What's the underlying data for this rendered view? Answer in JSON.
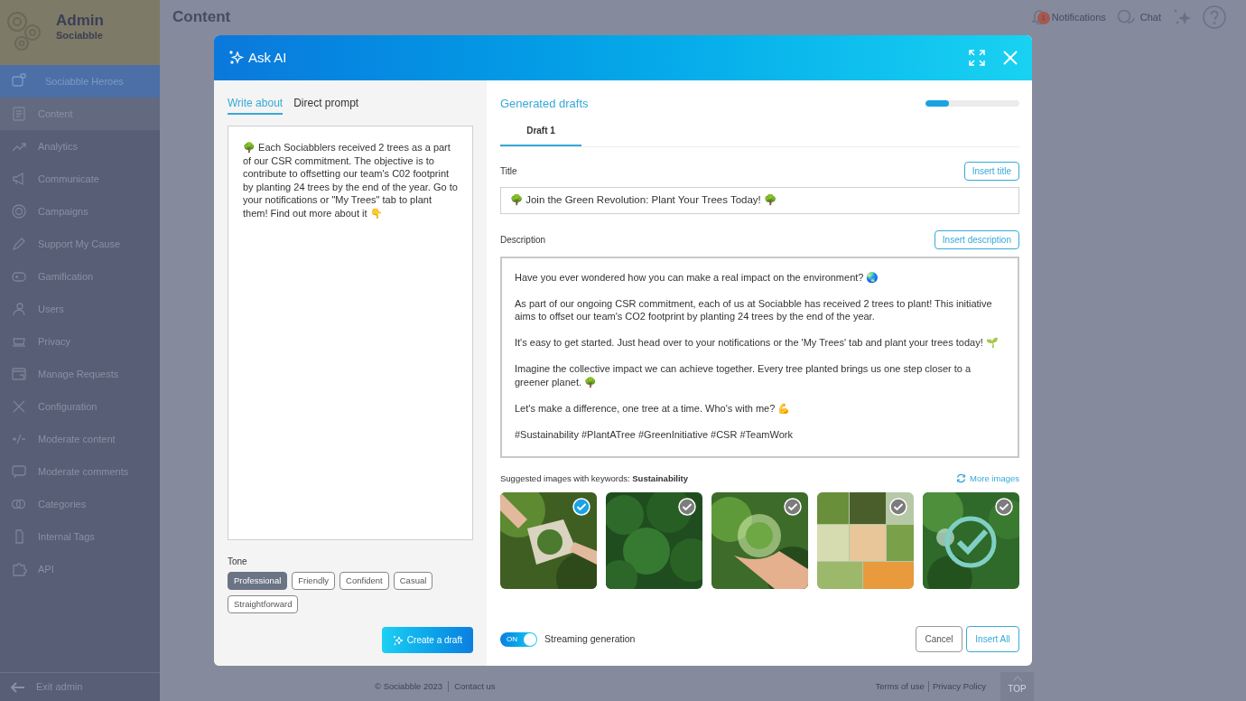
{
  "sidebar": {
    "title": "Admin",
    "subtitle": "Sociabble",
    "items": [
      {
        "label": "Sociabble Heroes",
        "selected": true,
        "kind": "heroes"
      },
      {
        "label": "Content",
        "selected": false,
        "kind": "content",
        "hover": true
      },
      {
        "label": "Analytics",
        "selected": false,
        "kind": "analytics"
      },
      {
        "label": "Communicate",
        "selected": false,
        "kind": "communicate"
      },
      {
        "label": "Campaigns",
        "selected": false,
        "kind": "campaigns"
      },
      {
        "label": "Support My Cause",
        "selected": false,
        "kind": "cause"
      },
      {
        "label": "Gamification",
        "selected": false,
        "kind": "gamification"
      },
      {
        "label": "Users",
        "selected": false,
        "kind": "users"
      },
      {
        "label": "Privacy",
        "selected": false,
        "kind": "privacy"
      },
      {
        "label": "Manage Requests",
        "selected": false,
        "kind": "requests"
      },
      {
        "label": "Configuration",
        "selected": false,
        "kind": "configuration"
      },
      {
        "label": "Moderate content",
        "selected": false,
        "kind": "moderate"
      },
      {
        "label": "Moderate comments",
        "selected": false,
        "kind": "comments"
      },
      {
        "label": "Categories",
        "selected": false,
        "kind": "categories"
      },
      {
        "label": "Internal Tags",
        "selected": false,
        "kind": "tags"
      },
      {
        "label": "API",
        "selected": false,
        "kind": "api"
      }
    ],
    "exit": "Exit admin"
  },
  "header": {
    "title": "Content",
    "notifications": {
      "label": "Notifications",
      "badge": "1"
    },
    "chat": "Chat"
  },
  "footer": {
    "copyright": "© Sociabble 2023",
    "contact": "Contact us",
    "terms": "Terms of use",
    "privacy": "Privacy Policy",
    "top": "TOP"
  },
  "dialog": {
    "title": "Ask AI",
    "left": {
      "tabs": [
        {
          "label": "Write about",
          "selected": true
        },
        {
          "label": "Direct prompt",
          "selected": false
        }
      ],
      "prompt": "🌳 Each Sociabblers received 2 trees as a part of our CSR commitment. The objective is to contribute to offsetting our team's C02 footprint by planting 24 trees by the end of the year. Go to your notifications or \"My Trees\" tab to plant them! Find out more about it 👇",
      "tone_label": "Tone",
      "tones": [
        {
          "label": "Professional",
          "selected": true
        },
        {
          "label": "Friendly",
          "selected": false
        },
        {
          "label": "Confident",
          "selected": false
        },
        {
          "label": "Casual",
          "selected": false
        },
        {
          "label": "Straightforward",
          "selected": false
        }
      ],
      "create_button": "Create a draft"
    },
    "right": {
      "heading": "Generated drafts",
      "progress": {
        "level": 0.25
      },
      "tabs": [
        {
          "label": "Draft 1",
          "selected": true
        }
      ],
      "title_label": "Title",
      "insert_title": "Insert title",
      "title_value": "🌳 Join the Green Revolution: Plant Your Trees Today! 🌳",
      "description_label": "Description",
      "insert_description": "Insert description",
      "description": [
        "Have you ever wondered how you can make a real impact on the environment? 🌏",
        "As part of our ongoing CSR commitment, each of us at Sociabble has received 2 trees to plant! This initiative aims to offset our team's CO2 footprint by planting 24 trees by the end of the year.",
        "It's easy to get started. Just head over to your notifications or the 'My Trees' tab and plant your trees today! 🌱",
        "Imagine the collective impact we can achieve together. Every tree planted brings us one step closer to a greener planet. 🌳",
        "Let's make a difference, one tree at a time. Who's with me? 💪",
        "#Sustainability #PlantATree #GreenInitiative #CSR #TeamWork"
      ],
      "images_label": "Suggested images with keywords: **Sustainability**",
      "more_images": "More images",
      "images": [
        {
          "kind": "picture",
          "selected": true
        },
        {
          "kind": "picture",
          "selected": false
        },
        {
          "kind": "picture",
          "selected": false
        },
        {
          "kind": "picture",
          "selected": false
        },
        {
          "kind": "picture",
          "selected": false
        }
      ],
      "streaming": {
        "on": true,
        "on_label": "ON",
        "label": "Streaming generation"
      },
      "cancel": "Cancel",
      "insert_all": "Insert All"
    }
  }
}
